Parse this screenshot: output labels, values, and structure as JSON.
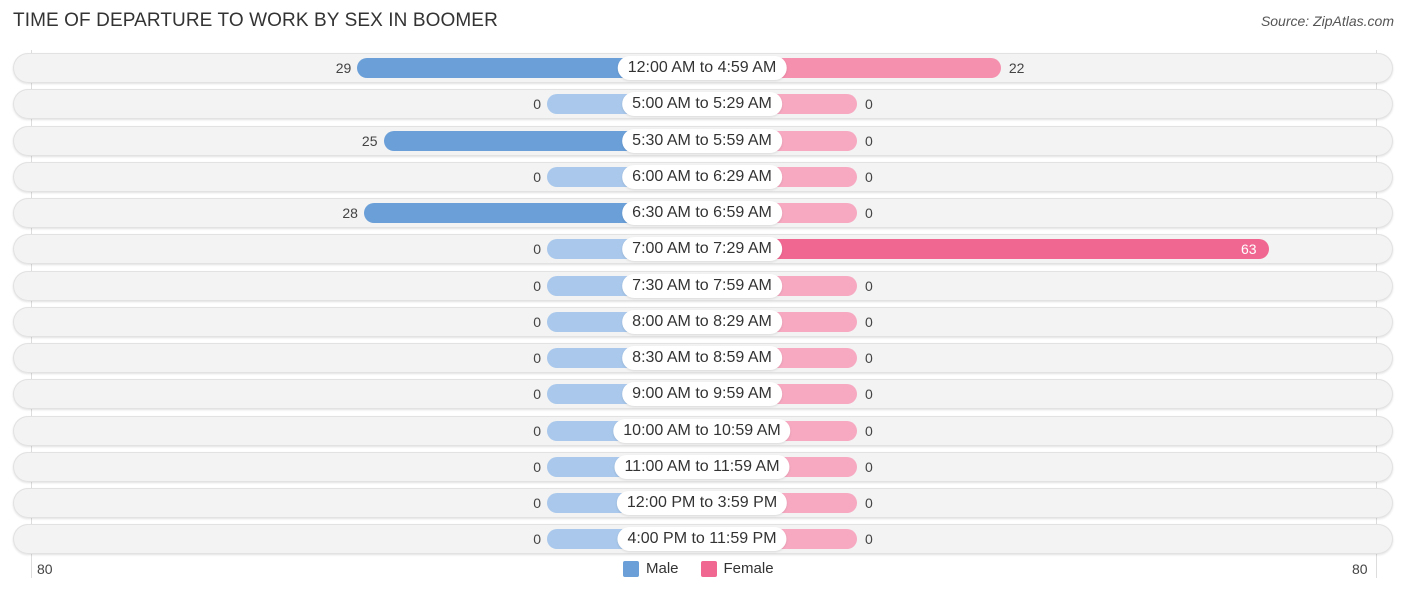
{
  "title": "TIME OF DEPARTURE TO WORK BY SEX IN BOOMER",
  "source": "Source: ZipAtlas.com",
  "colors": {
    "male": "#6a9fd8",
    "male_zero": "#a9c8eb",
    "female": "#f590ae",
    "female_zero": "#f6a9c1",
    "female_strong": "#f06792"
  },
  "chart_data": {
    "type": "bar",
    "orientation": "horizontal-diverging",
    "title": "TIME OF DEPARTURE TO WORK BY SEX IN BOOMER",
    "categories": [
      "12:00 AM to 4:59 AM",
      "5:00 AM to 5:29 AM",
      "5:30 AM to 5:59 AM",
      "6:00 AM to 6:29 AM",
      "6:30 AM to 6:59 AM",
      "7:00 AM to 7:29 AM",
      "7:30 AM to 7:59 AM",
      "8:00 AM to 8:29 AM",
      "8:30 AM to 8:59 AM",
      "9:00 AM to 9:59 AM",
      "10:00 AM to 10:59 AM",
      "11:00 AM to 11:59 AM",
      "12:00 PM to 3:59 PM",
      "4:00 PM to 11:59 PM"
    ],
    "series": [
      {
        "name": "Male",
        "values": [
          29,
          0,
          25,
          0,
          28,
          0,
          0,
          0,
          0,
          0,
          0,
          0,
          0,
          0
        ]
      },
      {
        "name": "Female",
        "values": [
          22,
          0,
          0,
          0,
          0,
          63,
          0,
          0,
          0,
          0,
          0,
          0,
          0,
          0
        ]
      }
    ],
    "axis": {
      "left_label": "80",
      "right_label": "80",
      "range": [
        0,
        80
      ]
    },
    "legend": {
      "position": "bottom-center",
      "entries": [
        "Male",
        "Female"
      ]
    }
  }
}
